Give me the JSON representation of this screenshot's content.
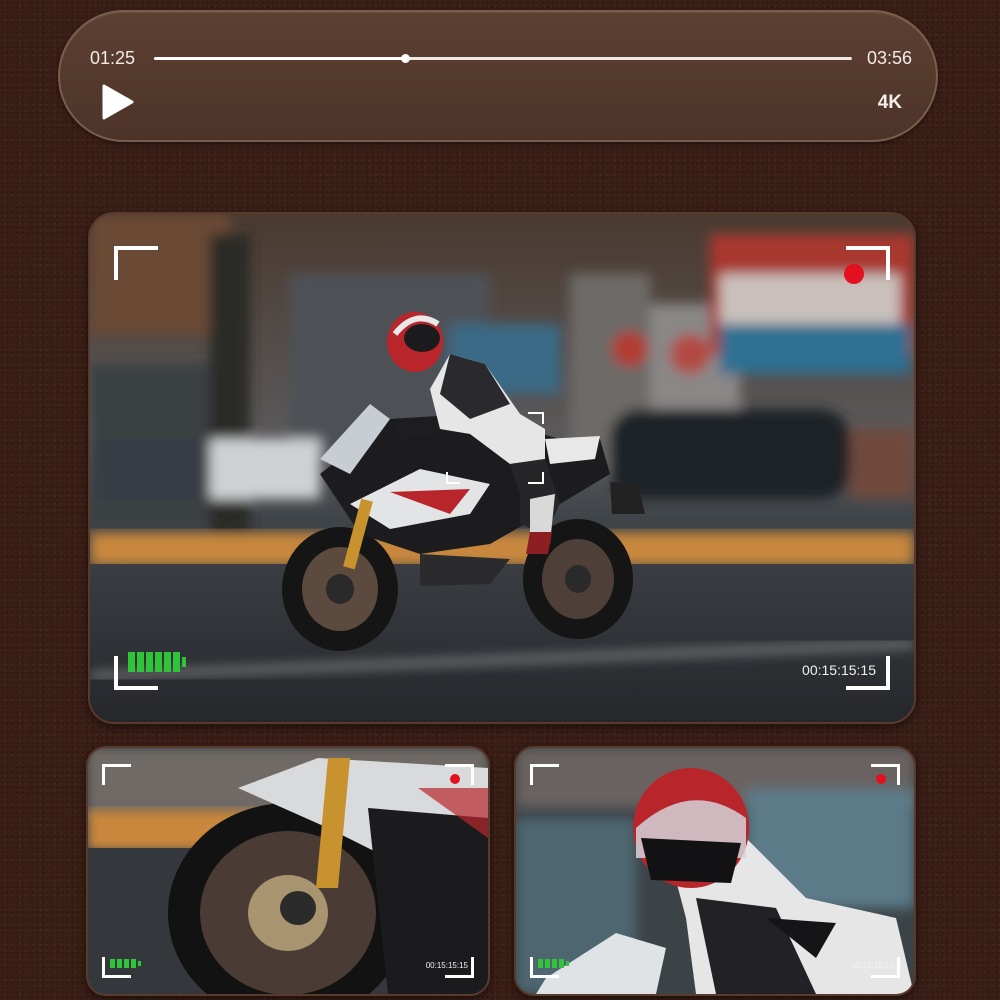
{
  "player": {
    "current_time": "01:25",
    "total_time": "03:56",
    "progress": 0.3602,
    "quality": "4K",
    "play_icon": "play-icon"
  },
  "viewfinder": {
    "main": {
      "timecode": "00:15:15:15",
      "recording": true,
      "battery_bars": 6
    },
    "left": {
      "timecode": "00:15:15:15",
      "recording": true,
      "battery_bars": 4
    },
    "right": {
      "timecode": "00:15:15:15",
      "recording": true,
      "battery_bars": 4
    }
  },
  "colors": {
    "background": "#3b1f16",
    "record": "#e3101f",
    "battery": "#2fc43a"
  }
}
